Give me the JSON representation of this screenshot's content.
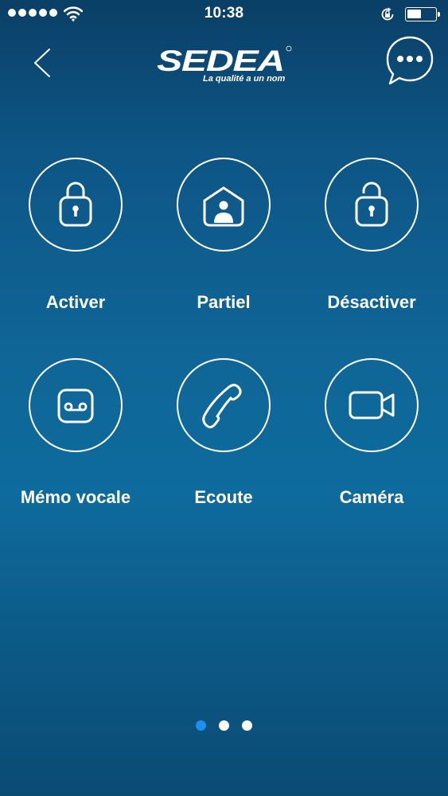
{
  "status_bar": {
    "time": "10:38",
    "signal_bars": 5,
    "battery_level": 0.5,
    "icons": [
      "signal-dots",
      "wifi-icon",
      "rotation-lock-icon",
      "battery-icon"
    ]
  },
  "header": {
    "back_icon": "chevron-left-icon",
    "logo_text": "SEDEA",
    "logo_tagline": "La qualité a un nom",
    "chat_icon": "chat-bubble-ellipsis-icon"
  },
  "actions": [
    {
      "label": "Activer",
      "icon": "lock-closed-icon"
    },
    {
      "label": "Partiel",
      "icon": "home-person-icon"
    },
    {
      "label": "Désactiver",
      "icon": "lock-open-icon"
    },
    {
      "label": "Mémo vocale",
      "icon": "voicemail-icon"
    },
    {
      "label": "Ecoute",
      "icon": "phone-handset-icon"
    },
    {
      "label": "Caméra",
      "icon": "video-camera-icon"
    }
  ],
  "pager": {
    "page_count": 3,
    "current_page": 1
  },
  "colors": {
    "background_top": "#0a3f66",
    "background_mid": "#0f6697",
    "foreground": "#ffffff",
    "pager_active": "#1e8ff2"
  }
}
